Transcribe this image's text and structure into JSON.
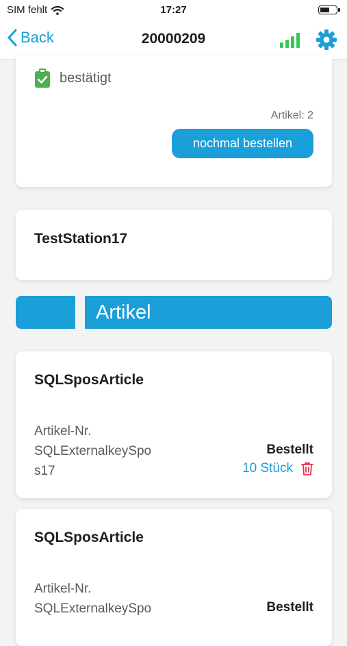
{
  "status_bar": {
    "carrier": "SIM fehlt",
    "time": "17:27",
    "battery_level": 0.5
  },
  "nav": {
    "back_label": "Back",
    "title": "20000209",
    "signal_color": "#34c759",
    "accent": "#1a9fd8"
  },
  "order": {
    "status_label": "bestätigt",
    "status_icon": "clipboard-check-icon",
    "status_color": "#4caf50",
    "article_count": "Artikel: 2",
    "reorder_label": "nochmal bestellen"
  },
  "station": {
    "name": "TestStation17"
  },
  "section": {
    "title": "Artikel"
  },
  "articles": [
    {
      "name": "SQLSposArticle",
      "nr_label": "Artikel-Nr.",
      "nr_line1": "SQLExternalkeySpo",
      "nr_line2": "s17",
      "state": "Bestellt",
      "quantity": "10 Stück",
      "delete_icon": "trash-icon"
    },
    {
      "name": "SQLSposArticle",
      "nr_label": "Artikel-Nr.",
      "nr_line1": "SQLExternalkeySpo",
      "state": "Bestellt"
    }
  ]
}
